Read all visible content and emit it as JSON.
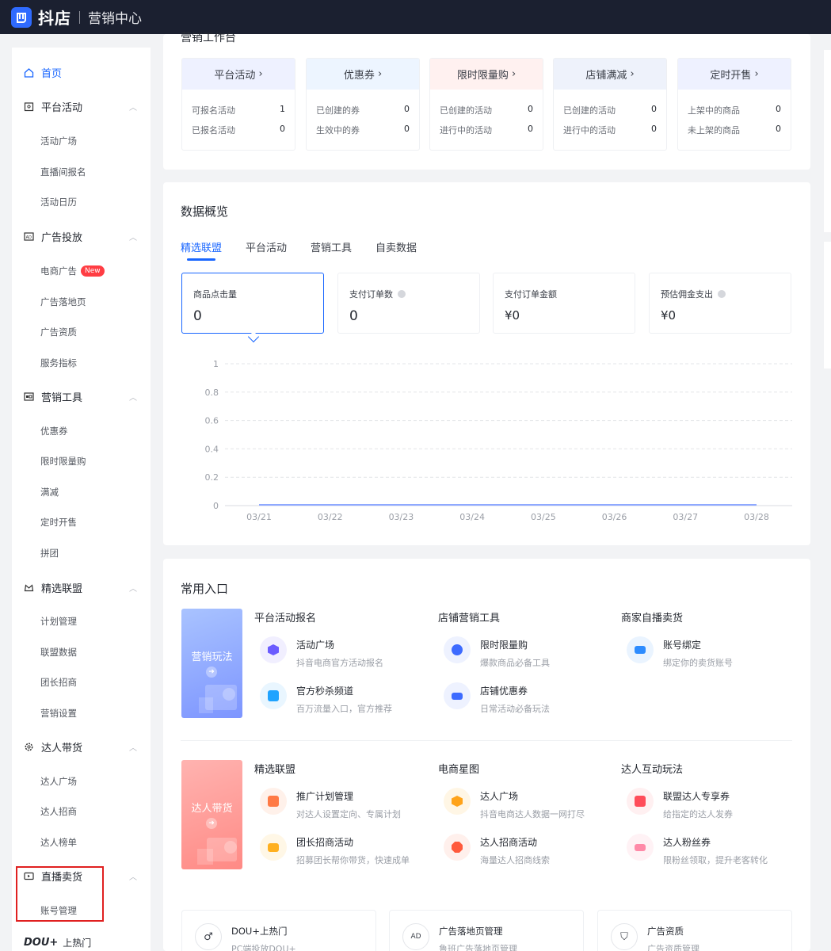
{
  "header": {
    "brand": "抖店",
    "subtitle": "营销中心",
    "brand_color": "#2f6bff"
  },
  "sidebar": {
    "home": "首页",
    "groups": [
      {
        "label": "平台活动",
        "icon": "calendar-icon",
        "items": [
          "活动广场",
          "直播间报名",
          "活动日历"
        ]
      },
      {
        "label": "广告投放",
        "icon": "ad-icon",
        "items": [
          "电商广告",
          "广告落地页",
          "广告资质",
          "服务指标"
        ],
        "badge": "New"
      },
      {
        "label": "营销工具",
        "icon": "tool-icon",
        "items": [
          "优惠券",
          "限时限量购",
          "满减",
          "定时开售",
          "拼团"
        ]
      },
      {
        "label": "精选联盟",
        "icon": "crown-icon",
        "items": [
          "计划管理",
          "联盟数据",
          "团长招商",
          "营销设置"
        ]
      },
      {
        "label": "达人带货",
        "icon": "gear-icon",
        "items": [
          "达人广场",
          "达人招商",
          "达人榜单"
        ]
      },
      {
        "label": "直播卖货",
        "icon": "live-icon",
        "items": [
          "账号管理"
        ]
      }
    ],
    "dou_logo": "DOU+",
    "dou_label": "上热门"
  },
  "workbench": {
    "title": "营销工作台",
    "cards": [
      {
        "title": "平台活动",
        "rows": [
          {
            "label": "可报名活动",
            "value": "1"
          },
          {
            "label": "已报名活动",
            "value": "0"
          }
        ]
      },
      {
        "title": "优惠券",
        "rows": [
          {
            "label": "已创建的券",
            "value": "0"
          },
          {
            "label": "生效中的券",
            "value": "0"
          }
        ]
      },
      {
        "title": "限时限量购",
        "rows": [
          {
            "label": "已创建的活动",
            "value": "0"
          },
          {
            "label": "进行中的活动",
            "value": "0"
          }
        ]
      },
      {
        "title": "店铺满减",
        "rows": [
          {
            "label": "已创建的活动",
            "value": "0"
          },
          {
            "label": "进行中的活动",
            "value": "0"
          }
        ]
      },
      {
        "title": "定时开售",
        "rows": [
          {
            "label": "上架中的商品",
            "value": "0"
          },
          {
            "label": "未上架的商品",
            "value": "0"
          }
        ]
      }
    ]
  },
  "overview": {
    "title": "数据概览",
    "tabs": [
      "精选联盟",
      "平台活动",
      "营销工具",
      "自卖数据"
    ],
    "metrics": [
      {
        "label": "商品点击量",
        "value": "0"
      },
      {
        "label": "支付订单数",
        "value": "0"
      },
      {
        "label": "支付订单金额",
        "value": "¥0"
      },
      {
        "label": "预估佣金支出",
        "value": "¥0"
      }
    ]
  },
  "chart_data": {
    "type": "line",
    "x": [
      "03/21",
      "03/22",
      "03/23",
      "03/24",
      "03/25",
      "03/26",
      "03/27",
      "03/28"
    ],
    "y_ticks": [
      "1",
      "0.8",
      "0.6",
      "0.4",
      "0.2",
      "0"
    ],
    "series": [
      {
        "values": [
          0,
          0,
          0,
          0,
          0,
          0,
          0,
          0
        ]
      }
    ],
    "ylim": [
      0,
      1
    ],
    "grid": true,
    "line_color": "#8fa9ff"
  },
  "entrances": {
    "title": "常用入口",
    "sections": [
      {
        "promo": "营销玩法",
        "columns": [
          {
            "head": "平台活动报名",
            "entries": [
              {
                "title": "活动广场",
                "desc": "抖音电商官方活动报名",
                "icon": "hexagon-icon",
                "color": "#6b5cff"
              },
              {
                "title": "官方秒杀频道",
                "desc": "百万流量入口，官方推荐",
                "icon": "bag-icon",
                "color": "#1fa3ff"
              }
            ]
          },
          {
            "head": "店铺营销工具",
            "entries": [
              {
                "title": "限时限量购",
                "desc": "爆款商品必备工具",
                "icon": "clock-icon",
                "color": "#3d6bff"
              },
              {
                "title": "店铺优惠券",
                "desc": "日常活动必备玩法",
                "icon": "ticket-icon",
                "color": "#3d6bff"
              }
            ]
          },
          {
            "head": "商家自播卖货",
            "entries": [
              {
                "title": "账号绑定",
                "desc": "绑定你的卖货账号",
                "icon": "id-card-icon",
                "color": "#2d8cff"
              }
            ]
          }
        ]
      },
      {
        "promo": "达人带货",
        "columns": [
          {
            "head": "精选联盟",
            "entries": [
              {
                "title": "推广计划管理",
                "desc": "对达人设置定向、专属计划",
                "icon": "grid-icon",
                "color": "#ff7a45"
              },
              {
                "title": "团长招商活动",
                "desc": "招募团长帮你带货，快速成单",
                "icon": "briefcase-icon",
                "color": "#ffb020"
              }
            ]
          },
          {
            "head": "电商星图",
            "entries": [
              {
                "title": "达人广场",
                "desc": "抖音电商达人数据一网打尽",
                "icon": "badge-icon",
                "color": "#ffa31a"
              },
              {
                "title": "达人招商活动",
                "desc": "海量达人招商线索",
                "icon": "flower-icon",
                "color": "#ff5a3c"
              }
            ]
          },
          {
            "head": "达人互动玩法",
            "entries": [
              {
                "title": "联盟达人专享券",
                "desc": "给指定的达人发券",
                "icon": "coupon-icon",
                "color": "#ff4d5a"
              },
              {
                "title": "达人粉丝券",
                "desc": "限粉丝领取，提升老客转化",
                "icon": "fan-ticket-icon",
                "color": "#ff8aa8"
              }
            ]
          }
        ]
      }
    ],
    "bottom": [
      {
        "title": "DOU+上热门",
        "desc": "PC端投放DOU+",
        "icon": "dou-icon"
      },
      {
        "title": "广告落地页管理",
        "desc": "鲁班广告落地页管理",
        "icon": "ad-page-icon"
      },
      {
        "title": "广告资质",
        "desc": "广告资质管理",
        "icon": "shield-icon"
      }
    ]
  }
}
